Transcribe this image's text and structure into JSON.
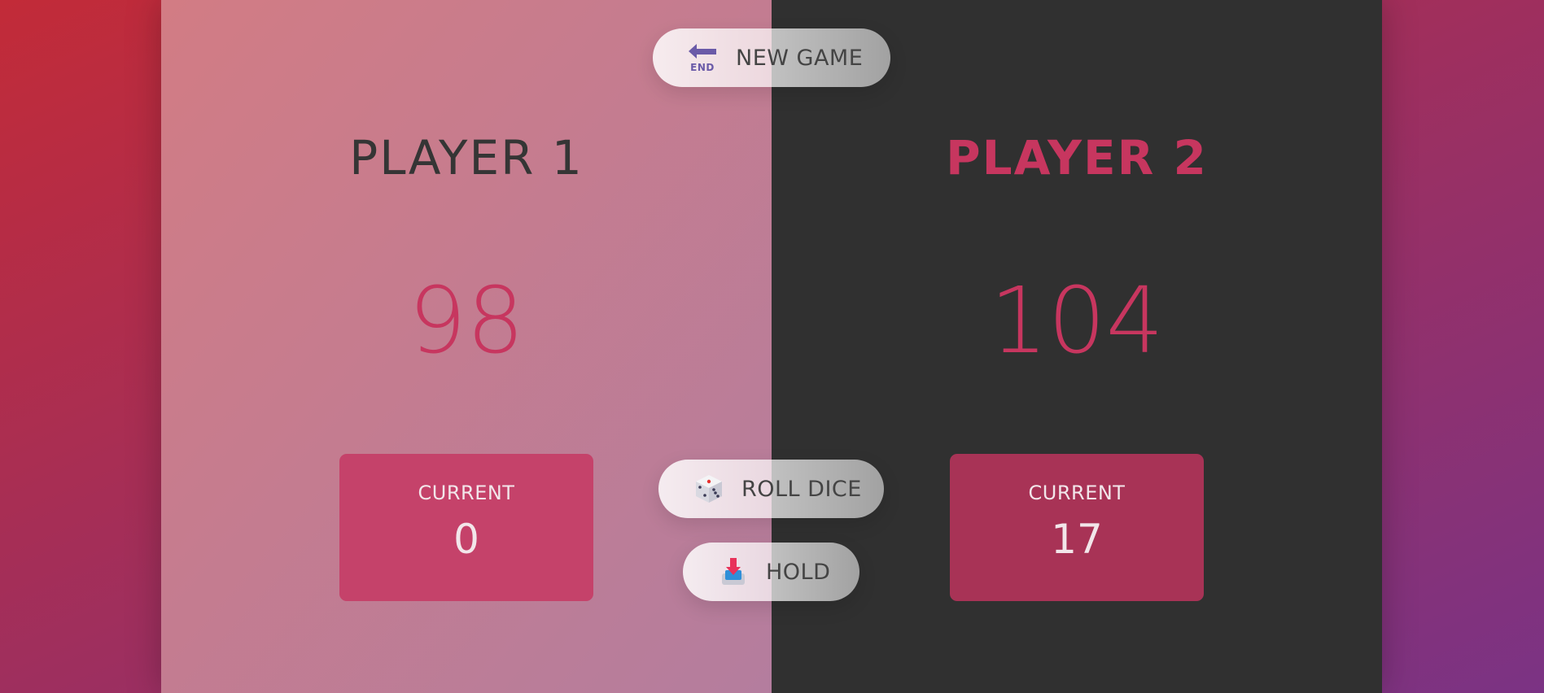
{
  "buttons": {
    "new_game": {
      "label": "NEW GAME",
      "icon": "end-arrow-icon"
    },
    "roll_dice": {
      "label": "ROLL DICE",
      "icon": "dice-icon"
    },
    "hold": {
      "label": "HOLD",
      "icon": "inbox-tray-icon"
    }
  },
  "players": [
    {
      "name": "PLAYER 1",
      "score": "98",
      "current_label": "CURRENT",
      "current_score": "0",
      "active": false
    },
    {
      "name": "PLAYER 2",
      "score": "104",
      "current_label": "CURRENT",
      "current_score": "17",
      "active": true
    }
  ],
  "colors": {
    "accent": "#c7365f",
    "player1_bg": "#d27c84",
    "player2_bg": "#303030",
    "current_box_1": "#c5426a",
    "current_box_2": "#a83356"
  }
}
